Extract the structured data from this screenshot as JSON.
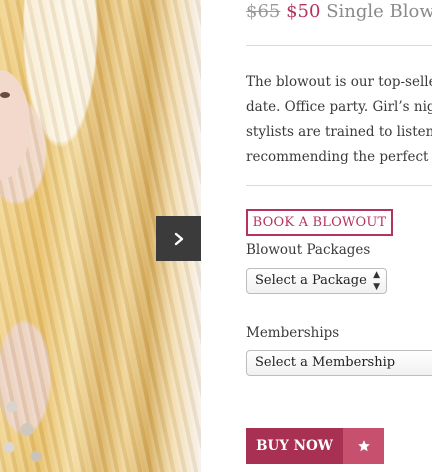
{
  "gallery": {
    "next_icon": "chevron-right-icon"
  },
  "product": {
    "old_price": "$65",
    "new_price": "$50",
    "name": "Single Blowo",
    "description_lines": [
      "The blowout is our top-seller",
      "date. Office party. Girl’s nigh",
      "stylists are trained to listen fi",
      "recommending the perfect st"
    ]
  },
  "book_button": {
    "label": "BOOK A BLOWOUT"
  },
  "packages": {
    "label": "Blowout Packages",
    "selected": "Select a Package",
    "icon": "updown-arrows-icon"
  },
  "memberships": {
    "label": "Memberships",
    "selected": "Select a Membership"
  },
  "buy_button": {
    "label": "BUY NOW"
  },
  "wishlist_button": {
    "icon": "star-icon"
  },
  "colors": {
    "accent": "#b5345f",
    "buy": "#a73053",
    "wishlist": "#c7506f",
    "arrow_bg": "#3b3b3b"
  }
}
